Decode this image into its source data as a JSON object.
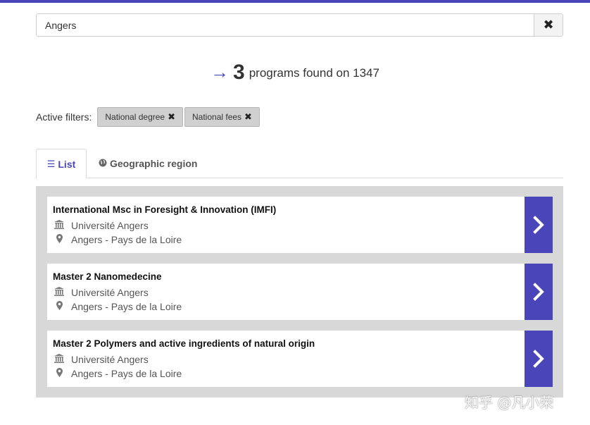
{
  "search": {
    "value": "Angers",
    "clear_icon": "close-icon"
  },
  "results": {
    "arrow": "→",
    "count": "3",
    "text": "programs found on 1347"
  },
  "filters": {
    "label": "Active filters:",
    "chips": [
      {
        "label": "National degree",
        "remove_icon": "✖"
      },
      {
        "label": "National fees",
        "remove_icon": "✖"
      }
    ]
  },
  "tabs": [
    {
      "label": "List",
      "icon": "list-icon",
      "glyph": "☰",
      "active": true
    },
    {
      "label": "Geographic region",
      "icon": "globe-icon",
      "glyph": "●",
      "active": false
    }
  ],
  "programs": [
    {
      "title": "International Msc in Foresight & Innovation (IMFI)",
      "institution": "Université Angers",
      "location": "Angers - Pays de la Loire"
    },
    {
      "title": "Master 2 Nanomedecine",
      "institution": "Université Angers",
      "location": "Angers - Pays de la Loire"
    },
    {
      "title": "Master 2 Polymers and active ingredients of natural origin",
      "institution": "Université Angers",
      "location": "Angers - Pays de la Loire"
    }
  ],
  "watermark": "知乎 @凡小荣",
  "colors": {
    "accent": "#4a45b8",
    "panel": "#d8d8d8",
    "chip": "#d0d0d0"
  }
}
